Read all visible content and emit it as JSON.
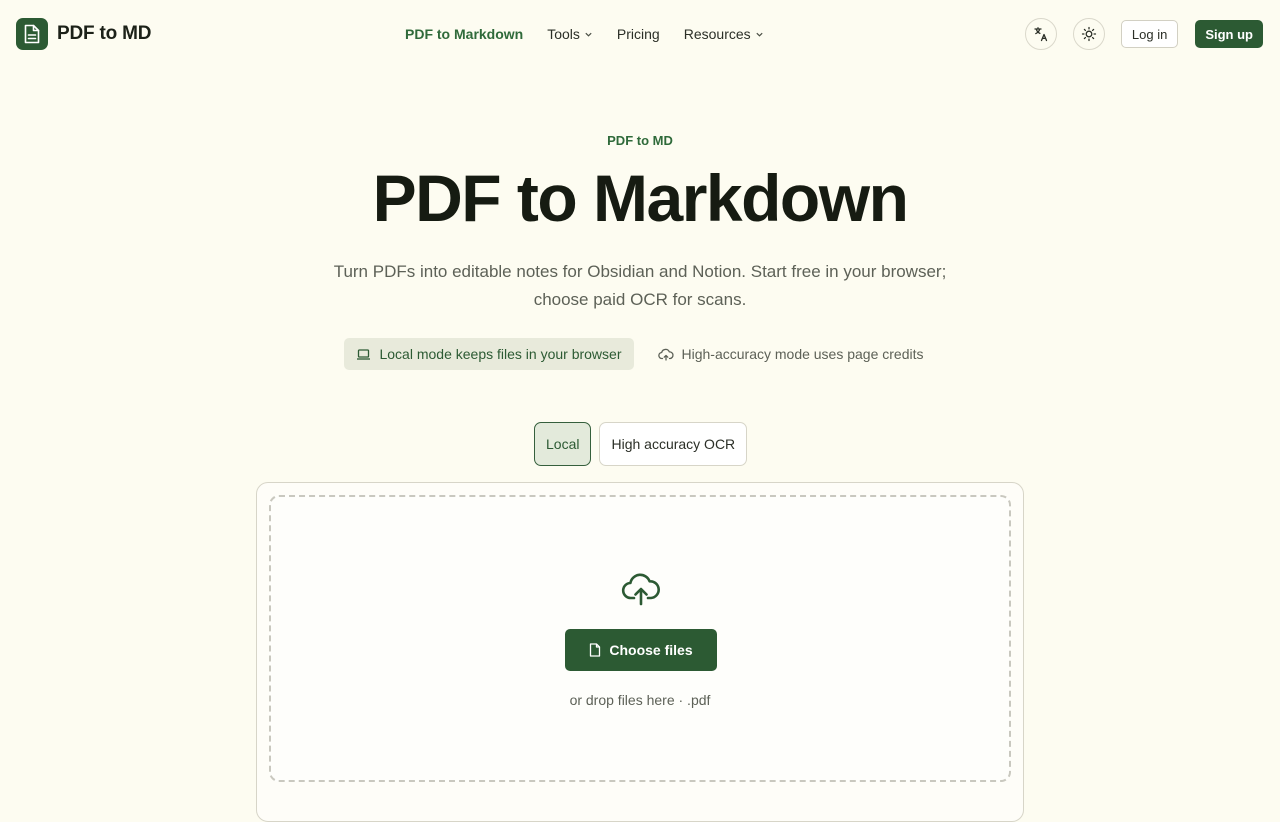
{
  "brand": {
    "name": "PDF to MD",
    "logo_icon": "document-icon"
  },
  "nav": {
    "items": [
      {
        "label": "PDF to Markdown",
        "active": true,
        "dropdown": false
      },
      {
        "label": "Tools",
        "active": false,
        "dropdown": true
      },
      {
        "label": "Pricing",
        "active": false,
        "dropdown": false
      },
      {
        "label": "Resources",
        "active": false,
        "dropdown": true
      }
    ]
  },
  "header_actions": {
    "language_icon": "translate-icon",
    "theme_icon": "sun-icon",
    "login_label": "Log in",
    "signup_label": "Sign up"
  },
  "hero": {
    "eyebrow": "PDF to MD",
    "title": "PDF to Markdown",
    "subtitle": "Turn PDFs into editable notes for Obsidian and Notion. Start free in your browser; choose paid OCR for scans."
  },
  "badges": {
    "local": {
      "label": "Local mode keeps files in your browser",
      "icon": "laptop-icon"
    },
    "cloud": {
      "label": "High-accuracy mode uses page credits",
      "icon": "cloud-icon"
    }
  },
  "modes": {
    "local_label": "Local",
    "ocr_label": "High accuracy OCR",
    "selected": "Local"
  },
  "upload": {
    "icon": "cloud-upload-icon",
    "button_label": "Choose files",
    "hint": "or drop files here · .pdf"
  },
  "colors": {
    "accent": "#2c5a33",
    "accent_text": "#2f6a3a",
    "background": "#fdfcf1"
  }
}
